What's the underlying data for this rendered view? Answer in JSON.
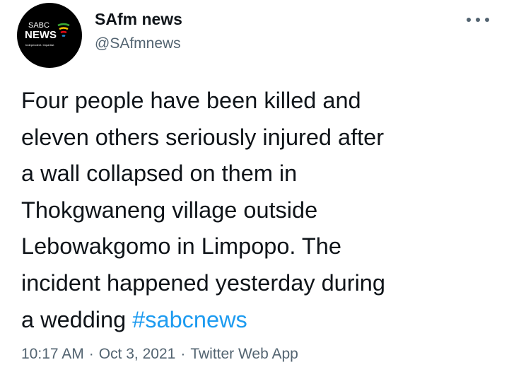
{
  "author": {
    "name": "SAfm news",
    "handle": "@SAfmnews",
    "avatar": {
      "logo_top": "SABC",
      "logo_main": "NEWS",
      "tagline": "Independent. Impartial.",
      "colors": {
        "background": "#000000",
        "text": "#ffffff",
        "arc_green": "#3aa935",
        "arc_yellow": "#f5c400",
        "arc_red": "#e30613",
        "arc_blue": "#1f8dd6"
      }
    }
  },
  "tweet": {
    "lines": [
      "Four people have been killed and",
      "eleven others seriously injured after",
      "a wall collapsed on them in",
      "Thokgwaneng village outside",
      "Lebowakgomo in Limpopo. The",
      "incident happened yesterday during"
    ],
    "last_line_text": "a wedding ",
    "hashtag": "#sabcnews"
  },
  "meta": {
    "time": "10:17 AM",
    "separator": "·",
    "date": "Oct 3, 2021",
    "source": "Twitter Web App"
  },
  "icons": {
    "more": "more-horizontal-icon"
  },
  "colors": {
    "text": "#0f1419",
    "secondary": "#536471",
    "link": "#1d9bf0"
  }
}
